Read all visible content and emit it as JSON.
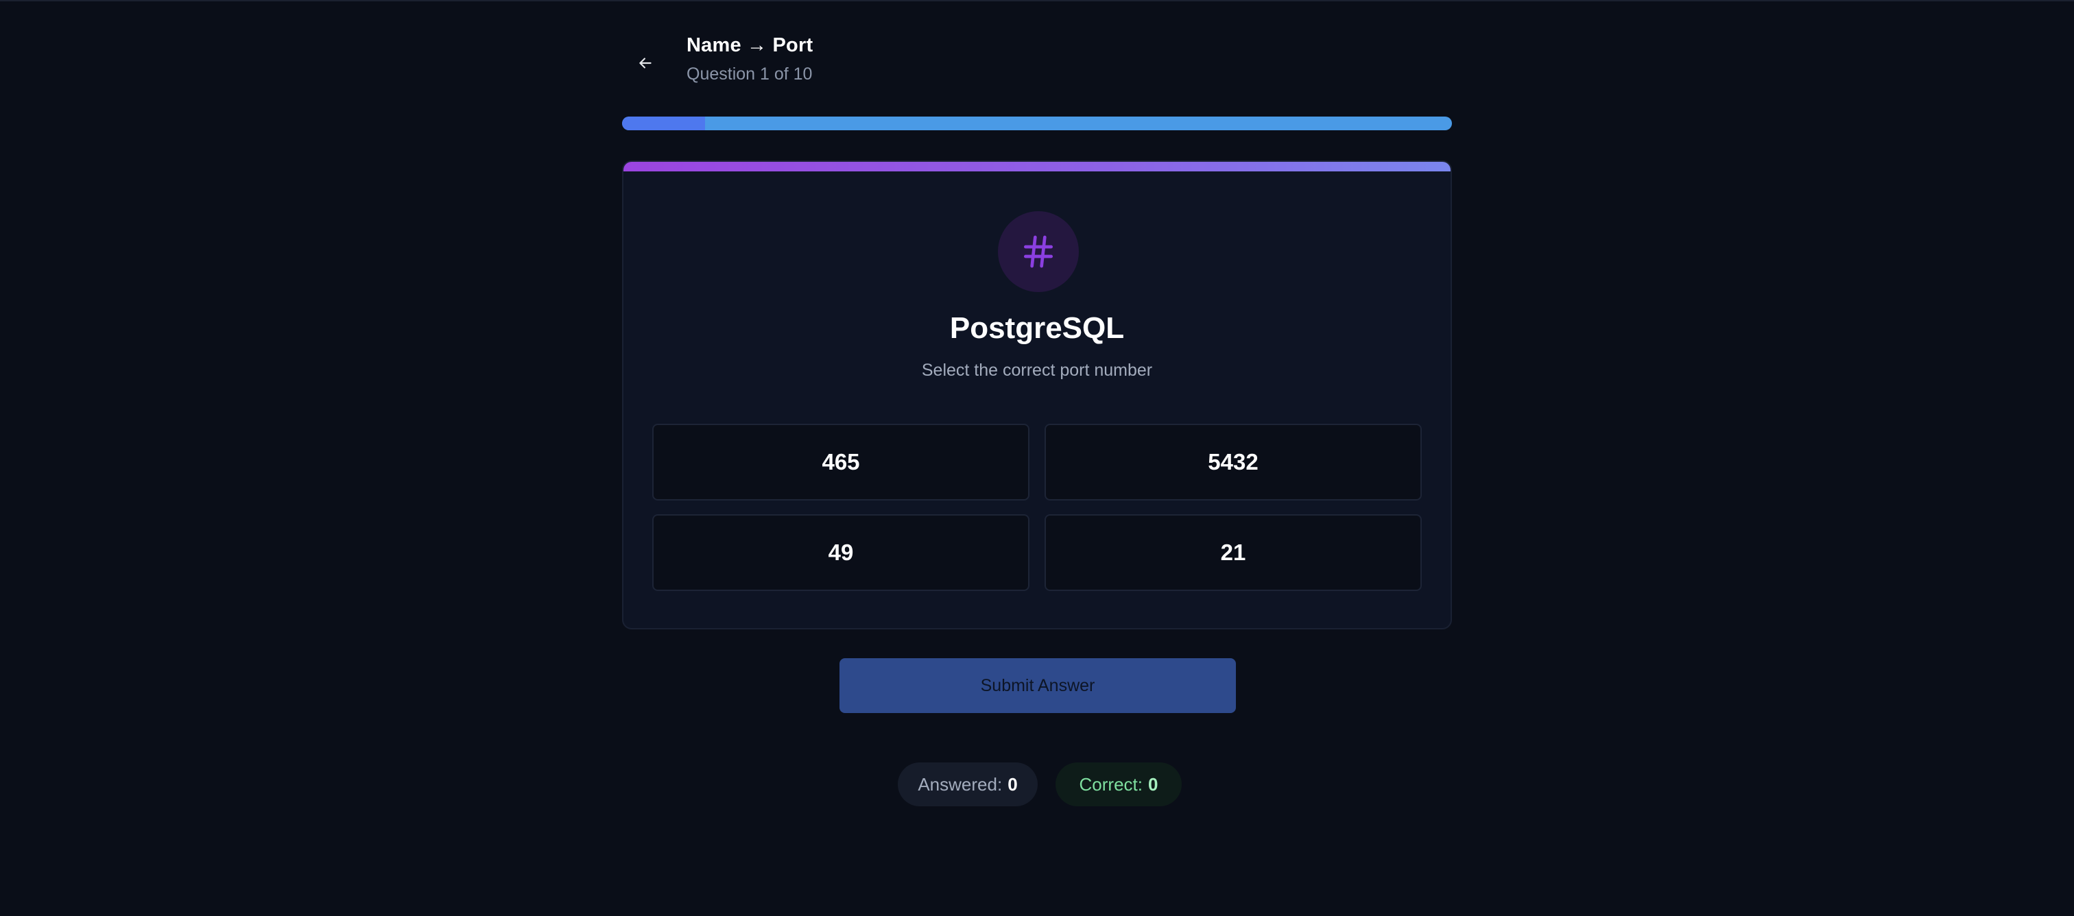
{
  "header": {
    "title": "Name → Port",
    "subtitle": "Question 1 of 10",
    "back_icon": "arrow-left-icon"
  },
  "progress": {
    "fraction": 0.1,
    "fill_color": "#4e78ee",
    "track_color": "#4a9ae6"
  },
  "card": {
    "icon": "hash-icon",
    "icon_color": "#8b3fe0",
    "service_name": "PostgreSQL",
    "instruction": "Select the correct port number",
    "accent_gradient": [
      "#9b45e0",
      "#7a86ee"
    ],
    "options": [
      "465",
      "5432",
      "49",
      "21"
    ]
  },
  "submit": {
    "label": "Submit Answer",
    "color": "#2e4a8c"
  },
  "stats": {
    "answered_label": "Answered:",
    "answered_value": "0",
    "correct_label": "Correct:",
    "correct_value": "0"
  }
}
